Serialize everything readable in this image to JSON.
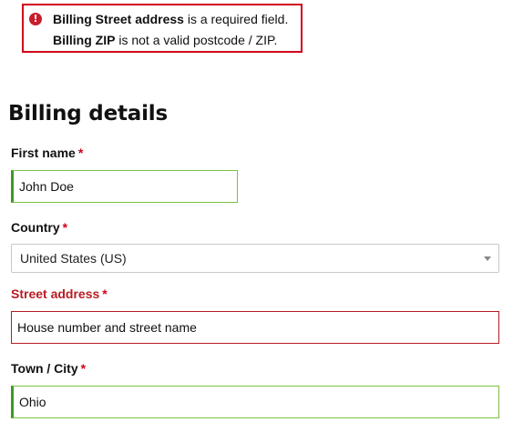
{
  "errors": [
    {
      "bold": "Billing Street address",
      "rest": " is a required field."
    },
    {
      "bold": "Billing ZIP",
      "rest": " is not a valid postcode / ZIP."
    }
  ],
  "icons": {
    "error": "exclamation-circle-icon",
    "select_arrow": "chevron-down-icon"
  },
  "colors": {
    "error": "#d0021b",
    "valid": "#3c9a26",
    "invalid_label": "#b81c23"
  },
  "section_title": "Billing details",
  "required_marker": "*",
  "fields": {
    "first_name": {
      "label": "First name",
      "value": "John Doe"
    },
    "country": {
      "label": "Country",
      "selected": "United States (US)"
    },
    "street_address": {
      "label": "Street address",
      "placeholder": "House number and street name",
      "value": ""
    },
    "city": {
      "label": "Town / City",
      "value": "Ohio"
    }
  }
}
